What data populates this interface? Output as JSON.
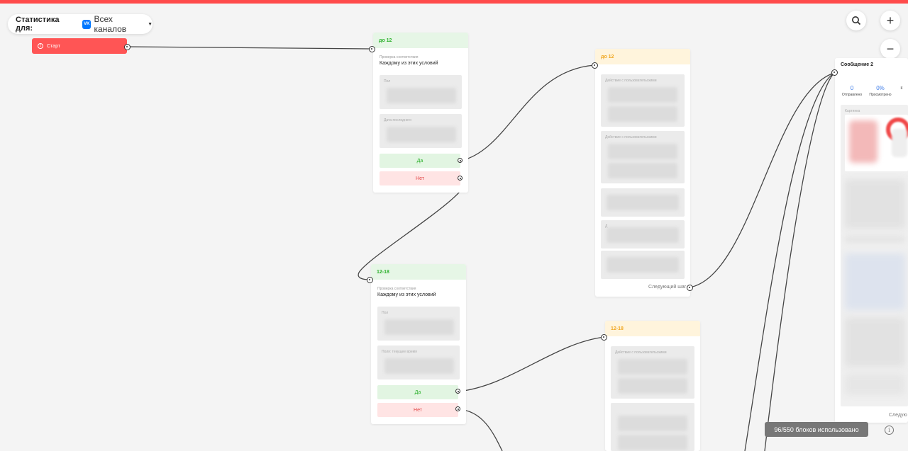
{
  "header": {
    "stats_label": "Статистика для:",
    "vk_badge": "VK",
    "channel_value": "Всех каналов"
  },
  "controls": {
    "search_icon": "search-icon",
    "zoom_in": "+",
    "zoom_out": "−"
  },
  "start_node": {
    "label": "Старт",
    "icon": "!",
    "color": "#ff5555"
  },
  "condition_cards": [
    {
      "title": "до 12",
      "subtitle": "Проверка соответствия",
      "rule": "Каждому из этих условий",
      "filters": [
        "Пол",
        "Дата последнего"
      ],
      "yes_label": "Да",
      "no_label": "Нет"
    },
    {
      "title": "12-18",
      "subtitle": "Проверка соответствия",
      "rule": "Каждому из этих условий",
      "filters": [
        "Пол",
        "Поля: текущее время"
      ],
      "yes_label": "Да",
      "no_label": "Нет"
    }
  ],
  "action_cards": [
    {
      "title": "до 12",
      "actions": [
        "Действие с пользовательскими",
        "Действие с пользовательскими",
        "",
        "Д",
        ""
      ],
      "next_label": "Следующий шаг"
    },
    {
      "title": "12-18",
      "actions": [
        "Действие с пользовательскими",
        ""
      ]
    }
  ],
  "message_card": {
    "title": "Сообщение 2",
    "stats": [
      {
        "value": "0",
        "label": "Отправлено"
      },
      {
        "value": "0%",
        "label": "Просмотрено"
      },
      {
        "value": "",
        "label": "К"
      }
    ],
    "image_label": "Картинка",
    "next_label": "Следую"
  },
  "footer": {
    "usage": "96/550 блоков использовано",
    "info_icon": "i"
  },
  "colors": {
    "accent_red": "#ff4b4b",
    "yes_green": "#2bb02b",
    "no_red": "#e04545",
    "header_yellow": "#f0a620",
    "stat_blue": "#3c7be8"
  }
}
